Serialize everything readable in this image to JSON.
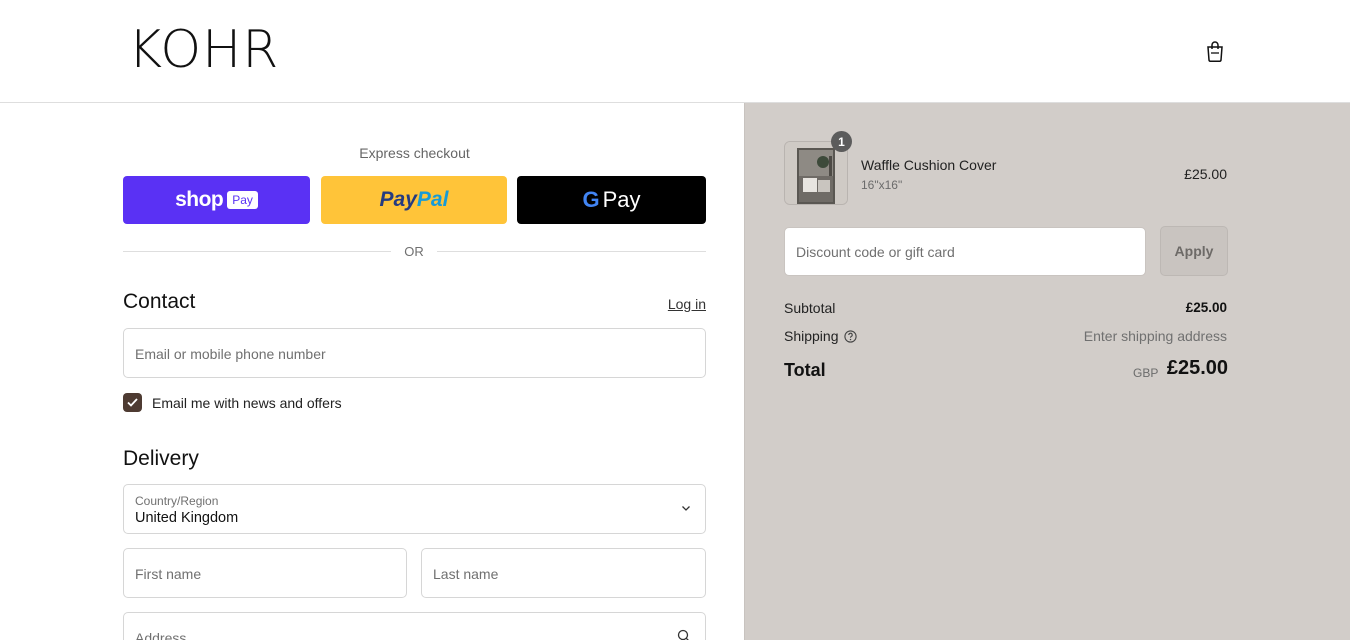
{
  "header": {
    "logo": "KOHR",
    "cart_icon": "shopping-bag-icon"
  },
  "checkout": {
    "express_title": "Express checkout",
    "shop_pay": {
      "word": "shop",
      "badge": "Pay"
    },
    "paypal": {
      "part1": "Pay",
      "part2": "Pal"
    },
    "gpay": {
      "g": "G",
      "word": "Pay"
    },
    "or_divider": "OR",
    "contact": {
      "heading": "Contact",
      "login_link": "Log in",
      "email_placeholder": "Email or mobile phone number",
      "newsletter_label": "Email me with news and offers",
      "newsletter_checked": true
    },
    "delivery": {
      "heading": "Delivery",
      "country_label": "Country/Region",
      "country_value": "United Kingdom",
      "first_name_placeholder": "First name",
      "last_name_placeholder": "Last name",
      "address_placeholder": "Address"
    }
  },
  "summary": {
    "item": {
      "quantity_badge": "1",
      "name": "Waffle Cushion Cover",
      "variant": "16\"x16\"",
      "price": "£25.00"
    },
    "discount_placeholder": "Discount code or gift card",
    "apply_label": "Apply",
    "subtotal_label": "Subtotal",
    "subtotal_value": "£25.00",
    "shipping_label": "Shipping",
    "shipping_value": "Enter shipping address",
    "total_label": "Total",
    "currency": "GBP",
    "total_value": "£25.00"
  },
  "colors": {
    "summary_bg": "#d2cdc9",
    "shop_pay": "#5a31f4",
    "paypal": "#ffc439",
    "gpay": "#000000",
    "checkbox": "#4e3b32"
  }
}
